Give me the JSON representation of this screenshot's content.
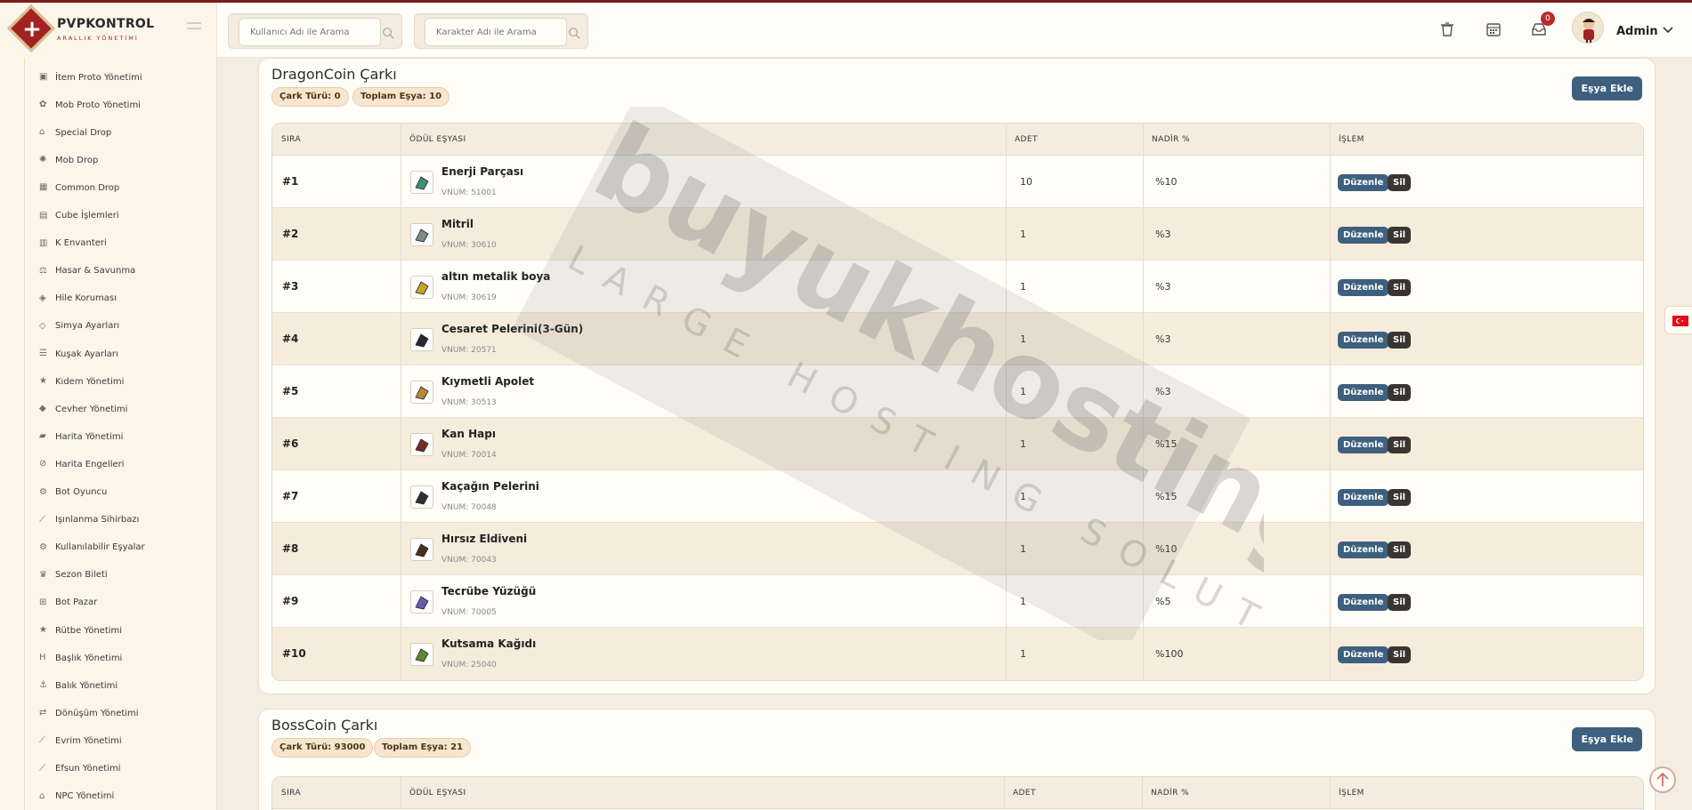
{
  "brand": {
    "title": "PVPKONTROL",
    "subtitle": "ARALLIK YÖNETİMİ"
  },
  "search": {
    "user_placeholder": "Kullanıcı Adı ile Arama",
    "char_placeholder": "Karakter Adı ile Arama"
  },
  "header": {
    "notification_count": "0",
    "admin_name": "Admin"
  },
  "sidebar": {
    "items": [
      {
        "label": "İtem Proto Yönetimi",
        "icon": "cube-icon"
      },
      {
        "label": "Mob Proto Yönetimi",
        "icon": "paw-icon"
      },
      {
        "label": "Special Drop",
        "icon": "gift-icon"
      },
      {
        "label": "Mob Drop",
        "icon": "bug-icon"
      },
      {
        "label": "Common Drop",
        "icon": "grid-icon"
      },
      {
        "label": "Cube İşlemleri",
        "icon": "cubes-icon"
      },
      {
        "label": "K Envanteri",
        "icon": "table-icon"
      },
      {
        "label": "Hasar & Savunma",
        "icon": "scale-icon"
      },
      {
        "label": "Hile Koruması",
        "icon": "shield-icon"
      },
      {
        "label": "Simya Ayarları",
        "icon": "gem-icon"
      },
      {
        "label": "Kuşak Ayarları",
        "icon": "sliders-icon"
      },
      {
        "label": "Kıdem Yönetimi",
        "icon": "star-icon"
      },
      {
        "label": "Cevher Yönetimi",
        "icon": "diamond-icon"
      },
      {
        "label": "Harita Yönetimi",
        "icon": "map-icon"
      },
      {
        "label": "Harita Engelleri",
        "icon": "ban-icon"
      },
      {
        "label": "Bot Oyuncu",
        "icon": "robot-icon"
      },
      {
        "label": "Işınlanma Sihirbazı",
        "icon": "wand-icon"
      },
      {
        "label": "Kullanılabilir Eşyalar",
        "icon": "cogs-icon"
      },
      {
        "label": "Sezon Bileti",
        "icon": "trophy-icon"
      },
      {
        "label": "Bot Pazar",
        "icon": "cart-icon"
      },
      {
        "label": "Rütbe Yönetimi",
        "icon": "star-icon"
      },
      {
        "label": "Başlık Yönetimi",
        "icon": "heading-icon"
      },
      {
        "label": "Balık Yönetimi",
        "icon": "anchor-icon"
      },
      {
        "label": "Dönüşüm Yönetimi",
        "icon": "shuffle-icon"
      },
      {
        "label": "Evrim Yönetimi",
        "icon": "wand-icon"
      },
      {
        "label": "Efsun Yönetimi",
        "icon": "wand-icon"
      },
      {
        "label": "NPC Yönetimi",
        "icon": "building-icon"
      }
    ]
  },
  "table_headers": {
    "sira": "SIRA",
    "odul": "ÖDÜL EŞYASI",
    "adet": "ADET",
    "nadir": "NADİR %",
    "islem": "İŞLEM"
  },
  "actions": {
    "edit": "Düzenle",
    "delete": "Sil",
    "add_item": "Eşya Ekle"
  },
  "wheels": [
    {
      "title": "DragonCoin Çarkı",
      "type_pill": "Çark Türü: 0",
      "total_pill": "Toplam Eşya: 10",
      "rows": [
        {
          "sira": "#1",
          "name": "Enerji Parçası",
          "vnum": "VNUM: 51001",
          "adet": "10",
          "nadir": "%10",
          "icon_color": "#3f8f7a"
        },
        {
          "sira": "#2",
          "name": "Mitril",
          "vnum": "VNUM: 30610",
          "adet": "1",
          "nadir": "%3",
          "icon_color": "#7d8a8c"
        },
        {
          "sira": "#3",
          "name": "altın metalik boya",
          "vnum": "VNUM: 30619",
          "adet": "1",
          "nadir": "%3",
          "icon_color": "#c9a42a"
        },
        {
          "sira": "#4",
          "name": "Cesaret Pelerini(3-Gün)",
          "vnum": "VNUM: 20571",
          "adet": "1",
          "nadir": "%3",
          "icon_color": "#2a2a2a"
        },
        {
          "sira": "#5",
          "name": "Kıymetli Apolet",
          "vnum": "VNUM: 30513",
          "adet": "1",
          "nadir": "%3",
          "icon_color": "#b88a2e"
        },
        {
          "sira": "#6",
          "name": "Kan Hapı",
          "vnum": "VNUM: 70014",
          "adet": "1",
          "nadir": "%15",
          "icon_color": "#7a2a2a"
        },
        {
          "sira": "#7",
          "name": "Kaçağın Pelerini",
          "vnum": "VNUM: 70048",
          "adet": "1",
          "nadir": "%15",
          "icon_color": "#2f2f2f"
        },
        {
          "sira": "#8",
          "name": "Hırsız Eldiveni",
          "vnum": "VNUM: 70043",
          "adet": "1",
          "nadir": "%10",
          "icon_color": "#4a3020"
        },
        {
          "sira": "#9",
          "name": "Tecrübe Yüzüğü",
          "vnum": "VNUM: 70005",
          "adet": "1",
          "nadir": "%5",
          "icon_color": "#6b5bb0"
        },
        {
          "sira": "#10",
          "name": "Kutsama Kağıdı",
          "vnum": "VNUM: 25040",
          "adet": "1",
          "nadir": "%100",
          "icon_color": "#5b8a2e"
        }
      ]
    },
    {
      "title": "BossCoin Çarkı",
      "type_pill": "Çark Türü: 93000",
      "total_pill": "Toplam Eşya: 21",
      "rows": []
    }
  ],
  "colors": {
    "accent": "#3e607e",
    "danger": "#a32323",
    "dark_button": "#3a3532"
  }
}
